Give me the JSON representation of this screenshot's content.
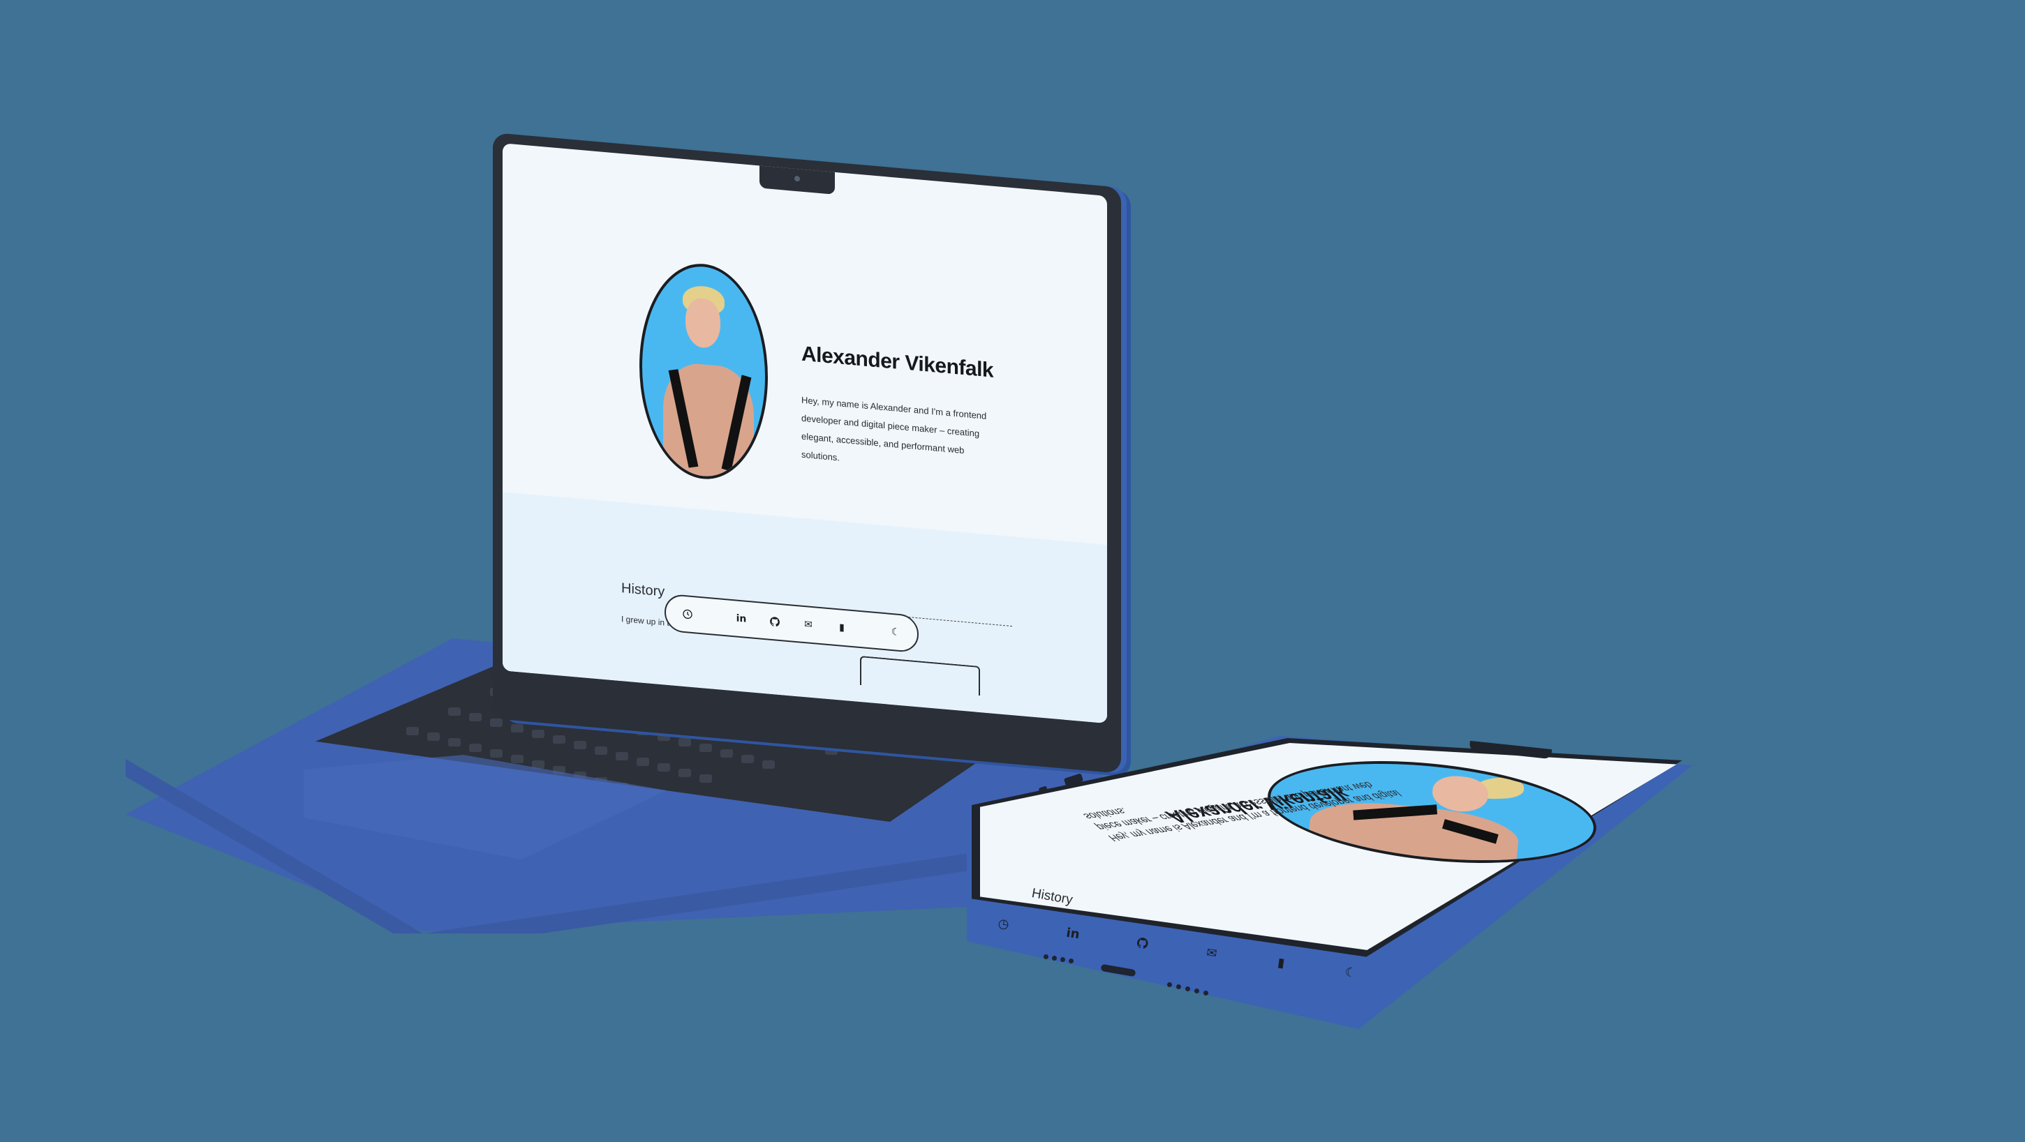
{
  "profile": {
    "name": "Alexander Vikenfalk",
    "bio": "Hey, my name is Alexander and I'm a frontend developer and digital piece maker – creating elegant, accessible, and performant web solutions.",
    "phone_bio": "Hey, my name is Alexander and I'm a frontend developer and digital piece maker – creating elegant, accessible, and performant web solutions."
  },
  "history": {
    "heading": "History",
    "intro": "I grew up in the quiet fishing village in the south of Sweden. While most"
  },
  "dock": {
    "items": [
      {
        "icon": "clock-icon",
        "glyph": "◷"
      },
      {
        "icon": "linkedin-icon",
        "glyph": "in"
      },
      {
        "icon": "github-icon",
        "glyph": ""
      },
      {
        "icon": "mail-icon",
        "glyph": "✉"
      },
      {
        "icon": "document-icon",
        "glyph": "▮"
      },
      {
        "icon": "moon-icon",
        "glyph": "☾"
      }
    ]
  },
  "colors": {
    "background": "#3f7294",
    "device_blue": "#4062b2",
    "screen_bg": "#f1f7fb",
    "avatar_bg": "#4ab8f0",
    "text": "#16181c"
  }
}
